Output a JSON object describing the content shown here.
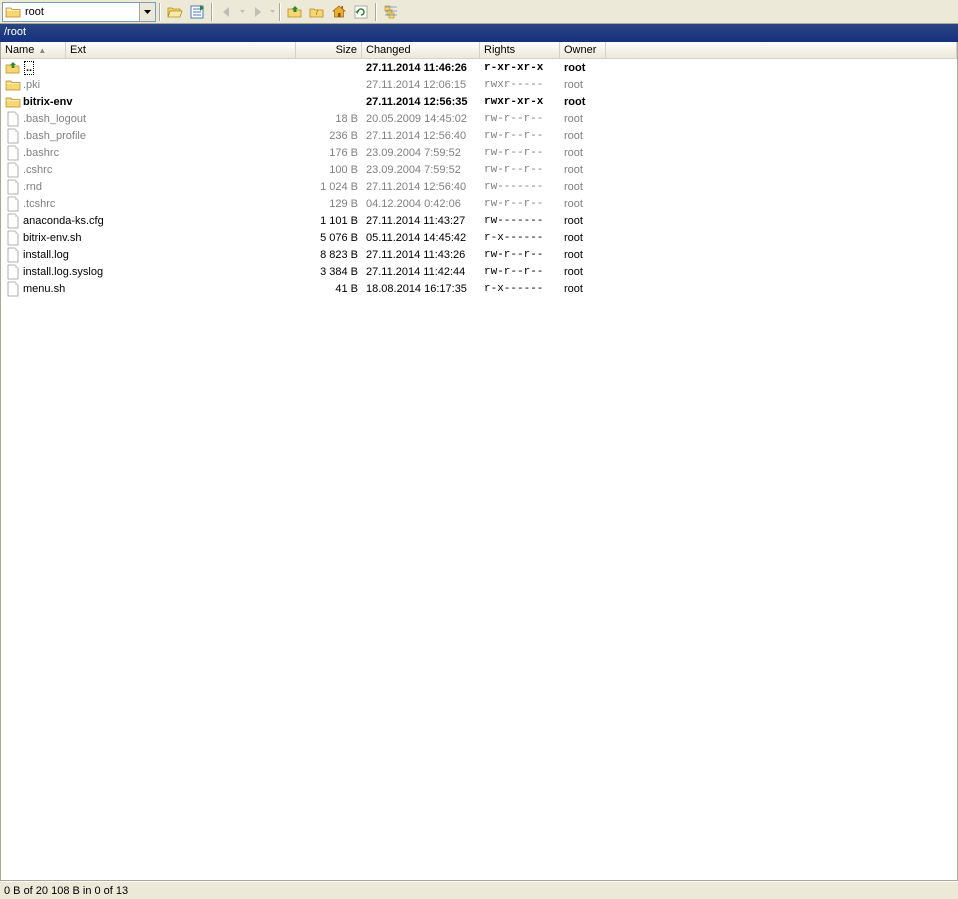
{
  "toolbar": {
    "path_value": "root"
  },
  "pathbar": {
    "path": "/root"
  },
  "columns": {
    "name": "Name",
    "ext": "Ext",
    "size": "Size",
    "changed": "Changed",
    "rights": "Rights",
    "owner": "Owner"
  },
  "files": [
    {
      "icon": "up",
      "name": "..",
      "ext": "",
      "size": "",
      "changed": "27.11.2014 11:46:26",
      "rights": "r-xr-xr-x",
      "owner": "root",
      "dim": false,
      "bold": true,
      "selected": true
    },
    {
      "icon": "folder",
      "name": ".pki",
      "ext": "",
      "size": "",
      "changed": "27.11.2014 12:06:15",
      "rights": "rwxr-----",
      "owner": "root",
      "dim": true,
      "bold": false
    },
    {
      "icon": "folder",
      "name": "bitrix-env",
      "ext": "",
      "size": "",
      "changed": "27.11.2014 12:56:35",
      "rights": "rwxr-xr-x",
      "owner": "root",
      "dim": false,
      "bold": true
    },
    {
      "icon": "file",
      "name": ".bash_logout",
      "ext": "",
      "size": "18 B",
      "changed": "20.05.2009 14:45:02",
      "rights": "rw-r--r--",
      "owner": "root",
      "dim": true,
      "bold": false
    },
    {
      "icon": "file",
      "name": ".bash_profile",
      "ext": "",
      "size": "236 B",
      "changed": "27.11.2014 12:56:40",
      "rights": "rw-r--r--",
      "owner": "root",
      "dim": true,
      "bold": false
    },
    {
      "icon": "file",
      "name": ".bashrc",
      "ext": "",
      "size": "176 B",
      "changed": "23.09.2004 7:59:52",
      "rights": "rw-r--r--",
      "owner": "root",
      "dim": true,
      "bold": false
    },
    {
      "icon": "file",
      "name": ".cshrc",
      "ext": "",
      "size": "100 B",
      "changed": "23.09.2004 7:59:52",
      "rights": "rw-r--r--",
      "owner": "root",
      "dim": true,
      "bold": false
    },
    {
      "icon": "file",
      "name": ".rnd",
      "ext": "",
      "size": "1 024 B",
      "changed": "27.11.2014 12:56:40",
      "rights": "rw-------",
      "owner": "root",
      "dim": true,
      "bold": false
    },
    {
      "icon": "file",
      "name": ".tcshrc",
      "ext": "",
      "size": "129 B",
      "changed": "04.12.2004 0:42:06",
      "rights": "rw-r--r--",
      "owner": "root",
      "dim": true,
      "bold": false
    },
    {
      "icon": "file",
      "name": "anaconda-ks.cfg",
      "ext": "",
      "size": "1 101 B",
      "changed": "27.11.2014 11:43:27",
      "rights": "rw-------",
      "owner": "root",
      "dim": false,
      "bold": false
    },
    {
      "icon": "file",
      "name": "bitrix-env.sh",
      "ext": "",
      "size": "5 076 B",
      "changed": "05.11.2014 14:45:42",
      "rights": "r-x------",
      "owner": "root",
      "dim": false,
      "bold": false
    },
    {
      "icon": "file",
      "name": "install.log",
      "ext": "",
      "size": "8 823 B",
      "changed": "27.11.2014 11:43:26",
      "rights": "rw-r--r--",
      "owner": "root",
      "dim": false,
      "bold": false
    },
    {
      "icon": "file",
      "name": "install.log.syslog",
      "ext": "",
      "size": "3 384 B",
      "changed": "27.11.2014 11:42:44",
      "rights": "rw-r--r--",
      "owner": "root",
      "dim": false,
      "bold": false
    },
    {
      "icon": "file",
      "name": "menu.sh",
      "ext": "",
      "size": "41 B",
      "changed": "18.08.2014 16:17:35",
      "rights": "r-x------",
      "owner": "root",
      "dim": false,
      "bold": false
    }
  ],
  "statusbar": {
    "text": "0 B of 20 108 B in 0 of 13"
  }
}
